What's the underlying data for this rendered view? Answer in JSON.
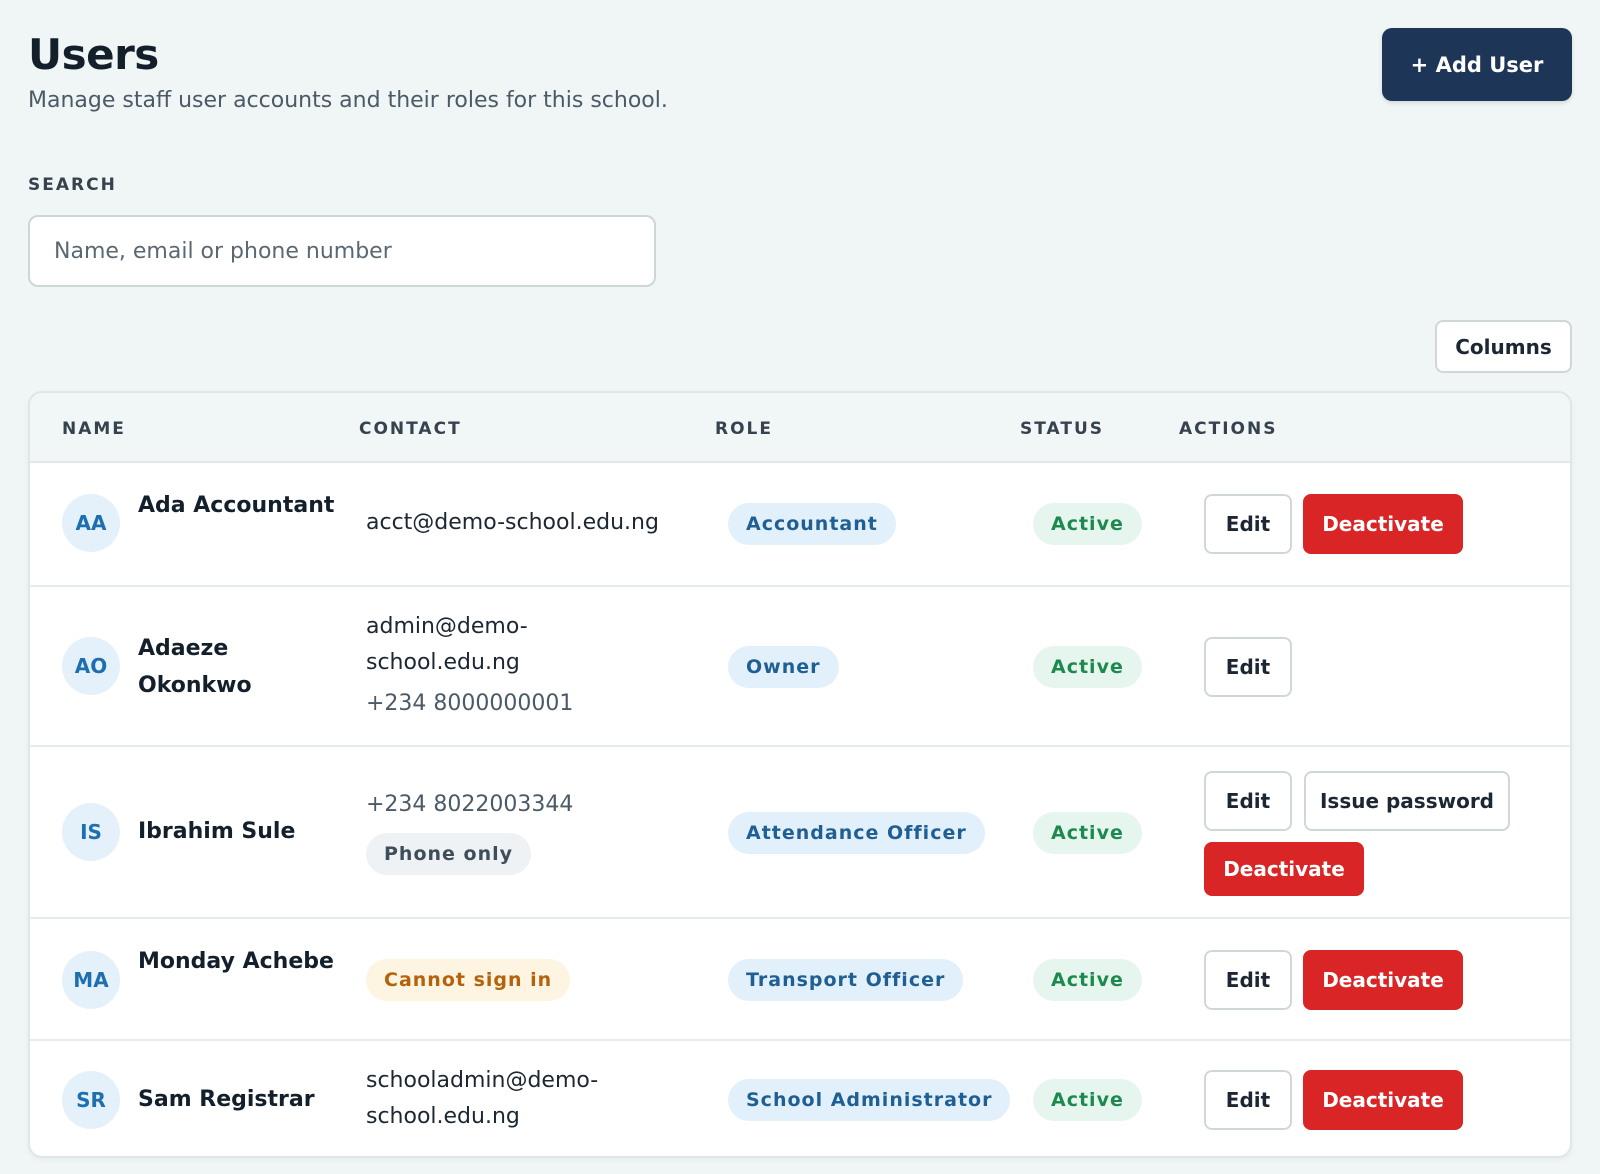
{
  "header": {
    "title": "Users",
    "subtitle": "Manage staff user accounts and their roles for this school.",
    "add_user_label": "+ Add User"
  },
  "search": {
    "label": "SEARCH",
    "placeholder": "Name, email or phone number",
    "value": ""
  },
  "columns_label": "Columns",
  "table": {
    "headers": {
      "name": "NAME",
      "contact": "CONTACT",
      "role": "ROLE",
      "status": "STATUS",
      "actions": "ACTIONS"
    },
    "rows": [
      {
        "initials": "AA",
        "name": "Ada Accountant",
        "contact": "acct@demo-school.edu.ng",
        "role": "Accountant",
        "status": "Active",
        "edit": "Edit",
        "deactivate": "Deactivate"
      },
      {
        "initials": "AO",
        "name": "Adaeze Okonkwo",
        "contact": "admin@demo-school.edu.ng",
        "phone": "+234 8000000001",
        "role": "Owner",
        "status": "Active",
        "edit": "Edit"
      },
      {
        "initials": "IS",
        "name": "Ibrahim Sule",
        "phone": "+234 8022003344",
        "contact_badge": "Phone only",
        "role": "Attendance Officer",
        "status": "Active",
        "edit": "Edit",
        "issue_password": "Issue password",
        "deactivate": "Deactivate"
      },
      {
        "initials": "MA",
        "name": "Monday Achebe",
        "contact_badge": "Cannot sign in",
        "role": "Transport Officer",
        "status": "Active",
        "edit": "Edit",
        "deactivate": "Deactivate"
      },
      {
        "initials": "SR",
        "name": "Sam Registrar",
        "contact": "schooladmin@demo-school.edu.ng",
        "role": "School Administrator",
        "status": "Active",
        "edit": "Edit",
        "deactivate": "Deactivate"
      }
    ]
  },
  "colors": {
    "primary": "#1d3557",
    "danger": "#d92525",
    "status_active": "#1c8a4e",
    "role_badge": "#1f5f93",
    "warning": "#b5620c"
  }
}
